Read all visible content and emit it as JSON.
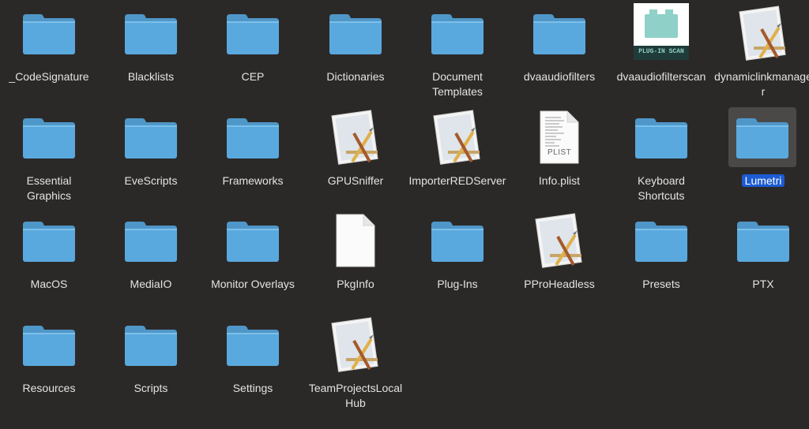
{
  "colors": {
    "background": "#2b2928",
    "folder": "#5aa9de",
    "folder_tab": "#4f97c9",
    "selection": "#1c5bd1"
  },
  "items": [
    {
      "label": "_CodeSignature",
      "kind": "folder",
      "icon": "folder-icon"
    },
    {
      "label": "Blacklists",
      "kind": "folder",
      "icon": "folder-icon"
    },
    {
      "label": "CEP",
      "kind": "folder",
      "icon": "folder-icon"
    },
    {
      "label": "Dictionaries",
      "kind": "folder",
      "icon": "folder-icon"
    },
    {
      "label": "Document\nTemplates",
      "kind": "folder",
      "icon": "folder-icon"
    },
    {
      "label": "dvaaudiofilters",
      "kind": "folder",
      "icon": "folder-icon"
    },
    {
      "label": "dvaaudiofilterscan",
      "kind": "plugin",
      "icon": "plugin-scan-icon",
      "badge": "PLUG-IN SCAN"
    },
    {
      "label": "dynamiclinkmanager",
      "kind": "app",
      "icon": "app-icon"
    },
    {
      "label": "Essential\nGraphics",
      "kind": "folder",
      "icon": "folder-icon"
    },
    {
      "label": "EveScripts",
      "kind": "folder",
      "icon": "folder-icon"
    },
    {
      "label": "Frameworks",
      "kind": "folder",
      "icon": "folder-icon"
    },
    {
      "label": "GPUSniffer",
      "kind": "app",
      "icon": "app-icon"
    },
    {
      "label": "ImporterREDServer",
      "kind": "app",
      "icon": "app-icon"
    },
    {
      "label": "Info.plist",
      "kind": "plist",
      "icon": "plist-icon",
      "badge": "PLIST"
    },
    {
      "label": "Keyboard\nShortcuts",
      "kind": "folder",
      "icon": "folder-icon"
    },
    {
      "label": "Lumetri",
      "kind": "folder",
      "icon": "folder-icon",
      "selected": true
    },
    {
      "label": "MacOS",
      "kind": "folder",
      "icon": "folder-icon"
    },
    {
      "label": "MediaIO",
      "kind": "folder",
      "icon": "folder-icon"
    },
    {
      "label": "Monitor Overlays",
      "kind": "folder",
      "icon": "folder-icon"
    },
    {
      "label": "PkgInfo",
      "kind": "file",
      "icon": "blank-file-icon"
    },
    {
      "label": "Plug-Ins",
      "kind": "folder",
      "icon": "folder-icon"
    },
    {
      "label": "PProHeadless",
      "kind": "app",
      "icon": "app-icon"
    },
    {
      "label": "Presets",
      "kind": "folder",
      "icon": "folder-icon"
    },
    {
      "label": "PTX",
      "kind": "folder",
      "icon": "folder-icon"
    },
    {
      "label": "Resources",
      "kind": "folder",
      "icon": "folder-icon"
    },
    {
      "label": "Scripts",
      "kind": "folder",
      "icon": "folder-icon"
    },
    {
      "label": "Settings",
      "kind": "folder",
      "icon": "folder-icon"
    },
    {
      "label": "TeamProjectsLocalHub",
      "kind": "app",
      "icon": "app-icon"
    }
  ]
}
